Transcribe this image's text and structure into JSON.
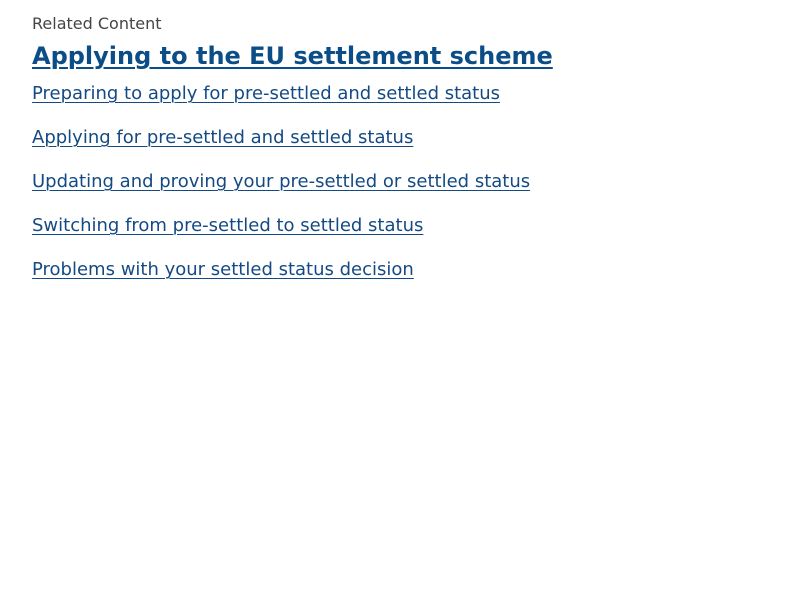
{
  "related": {
    "eyebrow": "Related Content",
    "heading": "Applying to the EU settlement scheme",
    "links": [
      "Preparing to apply for pre-settled and settled status",
      "Applying for pre-settled and settled status",
      "Updating and proving your pre-settled or settled status",
      "Switching from pre-settled to settled status",
      "Problems with your settled status decision"
    ]
  },
  "colors": {
    "heading": "#0b4d87",
    "link": "#144a83",
    "eyebrow": "#444444",
    "background": "#ffffff"
  }
}
